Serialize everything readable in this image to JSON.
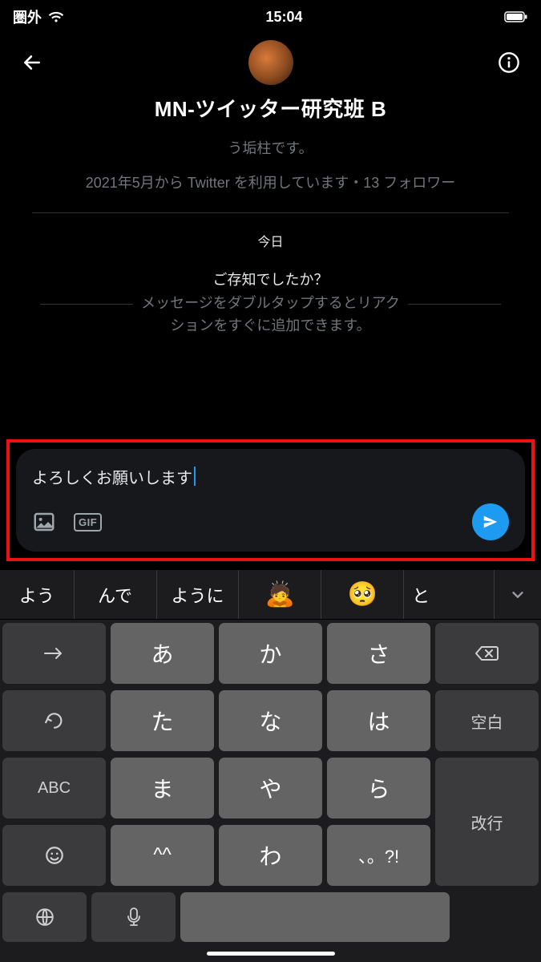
{
  "status": {
    "carrier": "圏外",
    "time": "15:04"
  },
  "header": {
    "title": "MN-ツイッター研究班 B"
  },
  "profile": {
    "bio_tail": "う垢柱です。",
    "joined_followers": "2021年5月から Twitter を利用しています・13 フォロワー"
  },
  "date_label": "今日",
  "tip": {
    "title": "ご存知でしたか？",
    "line1": "メッセージをダブルタップするとリアク",
    "line2": "ションをすぐに追加できます。"
  },
  "composer": {
    "text": "よろしくお願いします",
    "gif_label": "GIF"
  },
  "keyboard": {
    "suggestions": [
      "よう",
      "んで",
      "ように",
      "🙇",
      "🥺",
      "と"
    ],
    "rows": [
      [
        "→",
        "あ",
        "か",
        "さ",
        "⌫"
      ],
      [
        "↺",
        "た",
        "な",
        "は",
        "空白"
      ],
      [
        "ABC",
        "ま",
        "や",
        "ら",
        "改行"
      ],
      [
        "",
        "^^",
        "わ",
        "、。?!",
        ""
      ]
    ]
  }
}
